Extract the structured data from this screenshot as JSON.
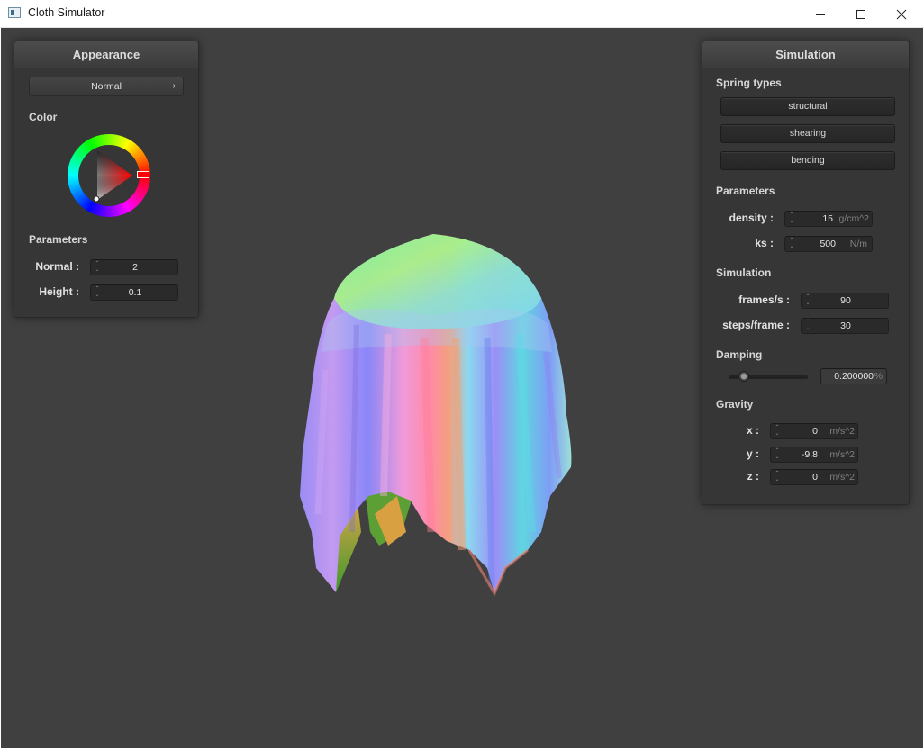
{
  "window": {
    "title": "Cloth Simulator",
    "icon": "app-window-icon"
  },
  "appearance": {
    "title": "Appearance",
    "shader": "Normal",
    "color_label": "Color",
    "color_value": "#ff0000",
    "parameters_label": "Parameters",
    "normal_label": "Normal :",
    "normal_value": "2",
    "height_label": "Height :",
    "height_value": "0.1"
  },
  "simulation": {
    "title": "Simulation",
    "spring_types_label": "Spring types",
    "spring_buttons": [
      "structural",
      "shearing",
      "bending"
    ],
    "parameters_label": "Parameters",
    "density_label": "density :",
    "density_value": "15",
    "density_unit": "g/cm^2",
    "ks_label": "ks :",
    "ks_value": "500",
    "ks_unit": "N/m",
    "sim_label": "Simulation",
    "fps_label": "frames/s :",
    "fps_value": "90",
    "steps_label": "steps/frame :",
    "steps_value": "30",
    "damping_label": "Damping",
    "damping_value": "0.200000",
    "damping_unit": "%",
    "damping_slider_fraction": 0.2,
    "gravity_label": "Gravity",
    "gx_label": "x :",
    "gx_value": "0",
    "gy_label": "y :",
    "gy_value": "-9.8",
    "gz_label": "z :",
    "gz_value": "0",
    "gravity_unit": "m/s^2"
  }
}
